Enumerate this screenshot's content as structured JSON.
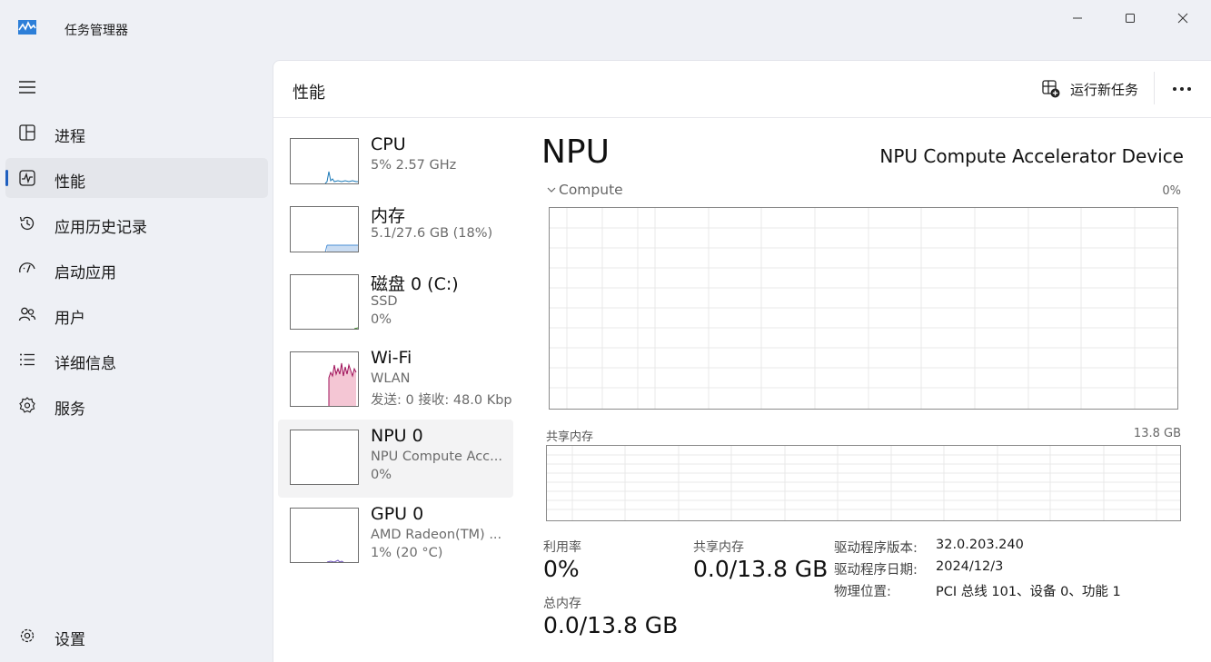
{
  "window": {
    "title": "任务管理器",
    "icon": "task-manager-icon"
  },
  "nav": {
    "items": [
      {
        "label": "进程",
        "icon": "processes-icon"
      },
      {
        "label": "性能",
        "icon": "performance-icon",
        "active": true
      },
      {
        "label": "应用历史记录",
        "icon": "history-icon"
      },
      {
        "label": "启动应用",
        "icon": "startup-icon"
      },
      {
        "label": "用户",
        "icon": "users-icon"
      },
      {
        "label": "详细信息",
        "icon": "details-icon"
      },
      {
        "label": "服务",
        "icon": "services-icon"
      }
    ],
    "settings_label": "设置"
  },
  "header": {
    "title": "性能",
    "run_task_label": "运行新任务"
  },
  "devices": [
    {
      "name": "CPU",
      "sub1": "5% 2.57 GHz",
      "sub2": ""
    },
    {
      "name": "内存",
      "sub1": "5.1/27.6 GB (18%)",
      "sub2": ""
    },
    {
      "name": "磁盘 0 (C:)",
      "sub1": "SSD",
      "sub2": "0%"
    },
    {
      "name": "Wi-Fi",
      "sub1": "WLAN",
      "sub2": "发送: 0 接收: 48.0 Kbp"
    },
    {
      "name": "NPU 0",
      "sub1": "NPU Compute Acc...",
      "sub2": "0%",
      "selected": true
    },
    {
      "name": "GPU 0",
      "sub1": "AMD Radeon(TM) ...",
      "sub2": "1% (20 °C)"
    }
  ],
  "detail": {
    "title": "NPU",
    "device_name": "NPU Compute Accelerator Device",
    "compute_label": "Compute",
    "compute_pct": "0%",
    "shared_mem_label": "共享内存",
    "shared_mem_max": "13.8 GB",
    "stats": {
      "util_label": "利用率",
      "util_value": "0%",
      "shared_label": "共享内存",
      "shared_value": "0.0/13.8 GB",
      "total_label": "总内存",
      "total_value": "0.0/13.8 GB"
    },
    "info": [
      {
        "key": "驱动程序版本:",
        "value": "32.0.203.240"
      },
      {
        "key": "驱动程序日期:",
        "value": "2024/12/3"
      },
      {
        "key": "物理位置:",
        "value": "PCI 总线 101、设备 0、功能 1"
      }
    ]
  },
  "colors": {
    "accent": "#1f5fbf",
    "cpu_line": "#1c7ab8",
    "memory_fill": "#c9dcf2",
    "wifi_line": "#a0125a",
    "wifi_fill": "#f4c6d4"
  }
}
